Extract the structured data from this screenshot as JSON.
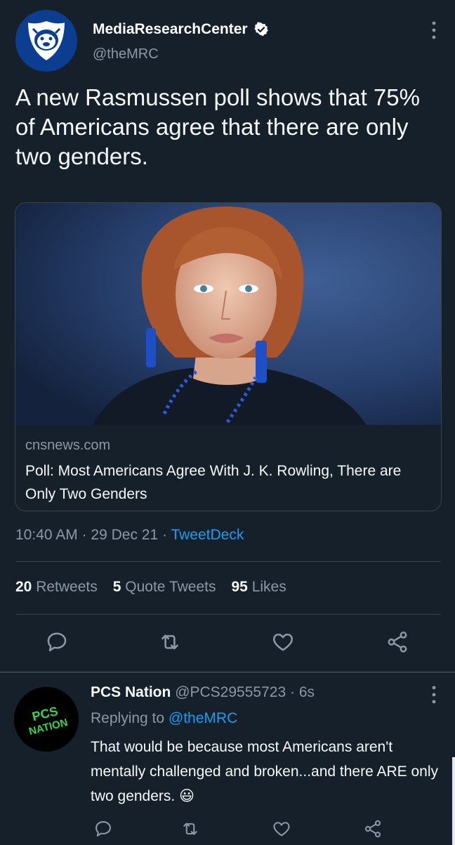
{
  "tweet": {
    "author": {
      "display_name": "MediaResearchCenter",
      "handle": "@theMRC",
      "verified": true,
      "avatar_icon": "bulldog-shield-logo"
    },
    "text": "A new Rasmussen poll shows that 75% of Americans agree that there are only two genders.",
    "card": {
      "domain": "cnsnews.com",
      "title": "Poll: Most Americans Agree With J. K. Rowling, There are Only Two Genders"
    },
    "time": "10:40 AM",
    "dot1": "·",
    "date": "29 Dec 21",
    "dot2": "·",
    "source": "TweetDeck",
    "stats": {
      "retweets_count": "20",
      "retweets_label": "Retweets",
      "quotes_count": "5",
      "quotes_label": "Quote Tweets",
      "likes_count": "95",
      "likes_label": "Likes"
    }
  },
  "reply": {
    "display_name": "PCS Nation",
    "handle": "@PCS29555723",
    "time_sep": "·",
    "time": "6s",
    "replying_label": "Replying to",
    "replying_to": "@theMRC",
    "text": "That would be because most Americans aren't mentally challenged and broken...and there ARE only two genders. 😃",
    "avatar_text": "PCS NATION"
  },
  "colors": {
    "background": "#15202b",
    "accent": "#1d9bf0",
    "muted": "#8b98a5",
    "border": "#38444d"
  }
}
